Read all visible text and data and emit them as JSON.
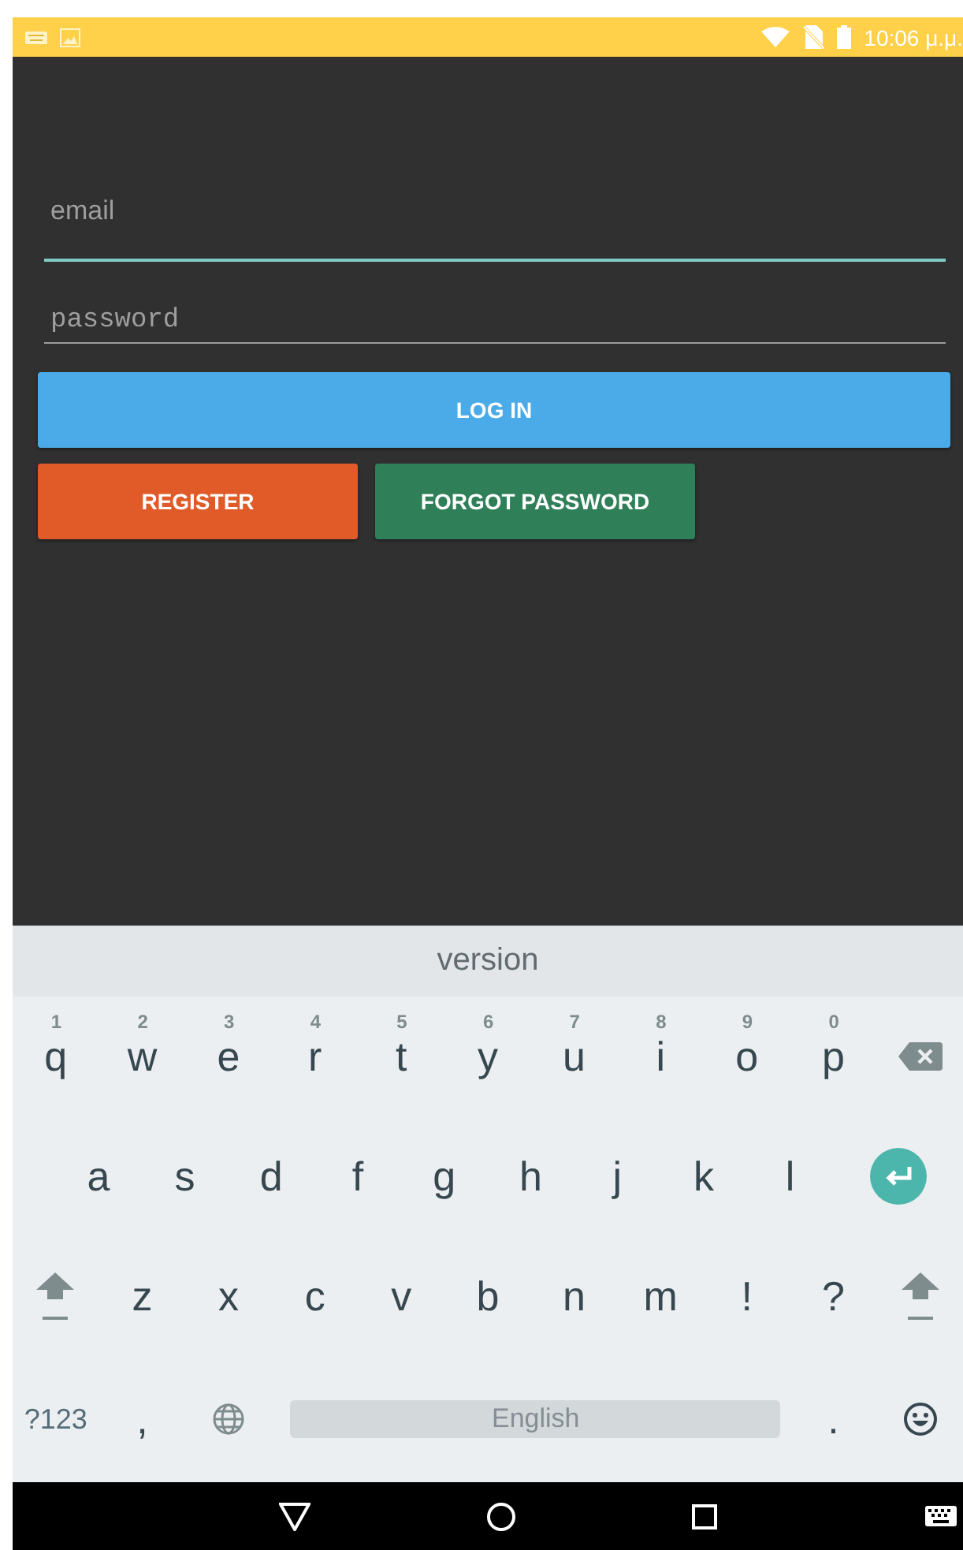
{
  "status_bar": {
    "time": "10:06 μ.μ."
  },
  "login_form": {
    "fields": [
      {
        "kind": "email",
        "placeholder": "email",
        "focused": true
      },
      {
        "kind": "password",
        "placeholder": "password",
        "focused": false
      }
    ],
    "buttons": [
      {
        "label": "LOG IN",
        "color": "#4aabe8",
        "wide": true
      },
      {
        "label": "REGISTER",
        "color": "#e05b28",
        "wide": false
      },
      {
        "label": "FORGOT PASSWORD",
        "color": "#2f7f58",
        "wide": false
      }
    ]
  },
  "keyboard": {
    "suggestion": "version",
    "rows": [
      {
        "keys": [
          {
            "kind": "letter",
            "label": "q",
            "hint": "1"
          },
          {
            "kind": "letter",
            "label": "w",
            "hint": "2"
          },
          {
            "kind": "letter",
            "label": "e",
            "hint": "3"
          },
          {
            "kind": "letter",
            "label": "r",
            "hint": "4"
          },
          {
            "kind": "letter",
            "label": "t",
            "hint": "5"
          },
          {
            "kind": "letter",
            "label": "y",
            "hint": "6"
          },
          {
            "kind": "letter",
            "label": "u",
            "hint": "7"
          },
          {
            "kind": "letter",
            "label": "i",
            "hint": "8"
          },
          {
            "kind": "letter",
            "label": "o",
            "hint": "9"
          },
          {
            "kind": "letter",
            "label": "p",
            "hint": "0"
          },
          {
            "kind": "backspace"
          }
        ]
      },
      {
        "keys": [
          {
            "kind": "letter",
            "label": "a"
          },
          {
            "kind": "letter",
            "label": "s"
          },
          {
            "kind": "letter",
            "label": "d"
          },
          {
            "kind": "letter",
            "label": "f"
          },
          {
            "kind": "letter",
            "label": "g"
          },
          {
            "kind": "letter",
            "label": "h"
          },
          {
            "kind": "letter",
            "label": "j"
          },
          {
            "kind": "letter",
            "label": "k"
          },
          {
            "kind": "letter",
            "label": "l"
          },
          {
            "kind": "enter"
          }
        ]
      },
      {
        "keys": [
          {
            "kind": "shift"
          },
          {
            "kind": "letter",
            "label": "z"
          },
          {
            "kind": "letter",
            "label": "x"
          },
          {
            "kind": "letter",
            "label": "c"
          },
          {
            "kind": "letter",
            "label": "v"
          },
          {
            "kind": "letter",
            "label": "b"
          },
          {
            "kind": "letter",
            "label": "n"
          },
          {
            "kind": "letter",
            "label": "m"
          },
          {
            "kind": "letter",
            "label": "!"
          },
          {
            "kind": "letter",
            "label": "?"
          },
          {
            "kind": "shift"
          }
        ]
      },
      {
        "keys": [
          {
            "kind": "symbols",
            "label": "?123"
          },
          {
            "kind": "letter",
            "label": ","
          },
          {
            "kind": "globe"
          },
          {
            "kind": "space",
            "label": "English"
          },
          {
            "kind": "letter",
            "label": "."
          },
          {
            "kind": "emoji"
          }
        ]
      }
    ]
  }
}
